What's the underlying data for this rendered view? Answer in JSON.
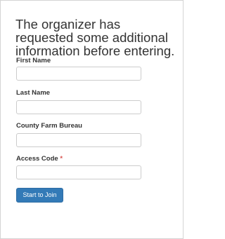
{
  "form": {
    "heading": "The organizer has requested some additional information before entering.",
    "fields": [
      {
        "label": "First Name",
        "value": "",
        "required": false
      },
      {
        "label": "Last Name",
        "value": "",
        "required": false
      },
      {
        "label": "County Farm Bureau",
        "value": "",
        "required": false
      },
      {
        "label": "Access Code",
        "value": "",
        "required": true,
        "required_marker": "*"
      }
    ],
    "submit_label": "Start to Join",
    "colors": {
      "primary_button": "#337ab7",
      "required_marker": "#d9534f",
      "text": "#333333"
    }
  }
}
